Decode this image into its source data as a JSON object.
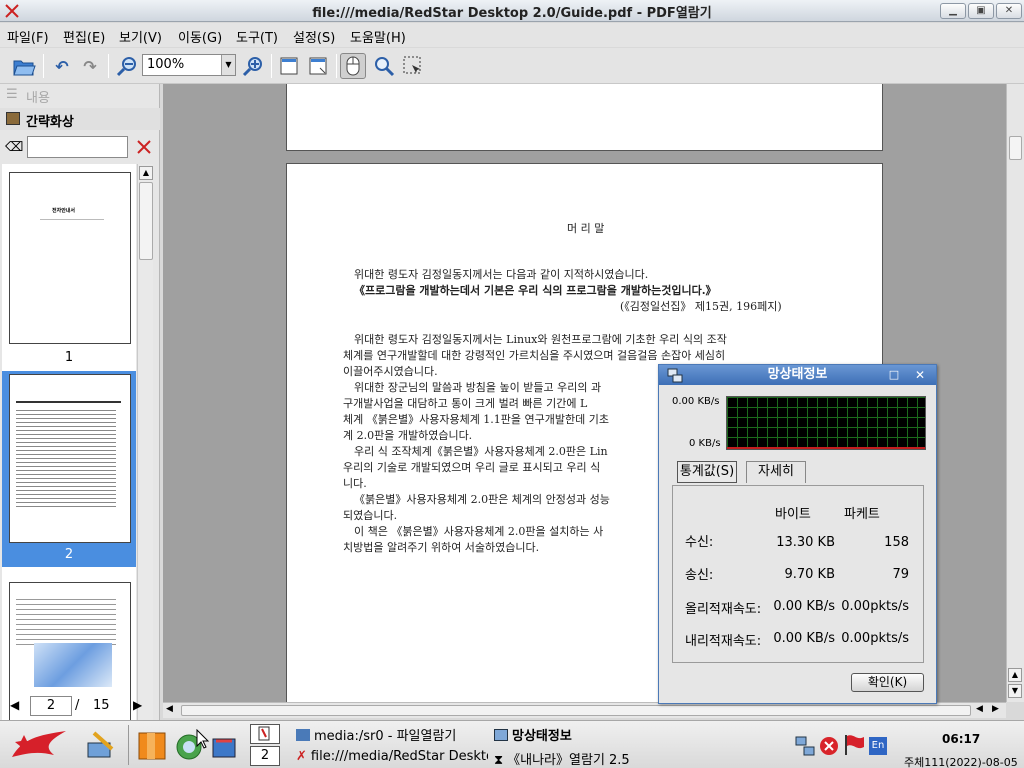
{
  "window": {
    "title": "file:///media/RedStar Desktop 2.0/Guide.pdf - PDF열람기"
  },
  "menu": [
    "파일(F)",
    "편집(E)",
    "보기(V)",
    "이동(G)",
    "도구(T)",
    "설정(S)",
    "도움말(H)"
  ],
  "toolbar": {
    "zoom": "100%"
  },
  "sidebar": {
    "tab_contents": "내용",
    "tab_thumbnails": "간략화상",
    "search_placeholder": "",
    "thumbs": [
      {
        "num": "1"
      },
      {
        "num": "2"
      }
    ],
    "current_page": "2",
    "page_sep": "/",
    "total_pages": "15"
  },
  "thumb1": {
    "title": "전자안내서"
  },
  "document": {
    "heading": "머 리 말",
    "quote_intro": "위대한 령도자 김정일동지께서는 다음과 같이 지적하시였습니다.",
    "quote": "《프로그람을 개발하는데서 기본은 우리 식의 프로그람을 개발하는것입니다.》",
    "quote_src": "(《김정일선집》 제15권, 196페지)",
    "p1_l1": "위대한 령도자 김정일동지께서는 Linux와 원천프로그람에 기초한 우리 식의 조작",
    "p1_l2": "체계를 연구개발할데 대한 강령적인 가르치심을 주시였으며 걸음걸음 손잡아 세심히",
    "p1_l3": "이끌어주시였습니다.",
    "p2_l1": "위대한 장군님의 말씀과 방침을 높이 받들고 우리의 과",
    "p2_l2": "구개발사업을 대담하고 통이 크게 벌려 빠른 기간에 L",
    "p2_l3": "체계 《붉은별》사용자용체계 1.1판을 연구개발한데 기초",
    "p2_l4": "계 2.0판을 개발하였습니다.",
    "p3_l1": "우리 식 조작체계《붉은별》사용자용체계 2.0판은 Lin",
    "p3_l2": "우리의 기술로 개발되였으며 우리 글로 표시되고 우리 식",
    "p3_l3": "니다.",
    "p4_l1": "《붉은별》사용자용체계 2.0판은 체계의 안정성과 성능",
    "p4_l2": "되였습니다.",
    "p5_l1": "이 책은 《붉은별》사용자용체계 2.0판을 설치하는 사",
    "p5_l2": "치방법을 알려주기 위하여 서술하였습니다."
  },
  "dialog": {
    "title": "망상태정보",
    "graph_top": "0.00 KB/s",
    "graph_bottom": "0 KB/s",
    "tab_stats": "통계값(S)",
    "tab_detail": "자세히",
    "col_bytes": "바이트",
    "col_packets": "파케트",
    "rows": [
      {
        "label": "수신:",
        "bytes": "13.30 KB",
        "packets": "158"
      },
      {
        "label": "송신:",
        "bytes": "9.70 KB",
        "packets": "79"
      },
      {
        "label": "올리적재속도:",
        "bytes": "0.00 KB/s",
        "packets": "0.00pkts/s"
      },
      {
        "label": "내리적재속도:",
        "bytes": "0.00 KB/s",
        "packets": "0.00pkts/s"
      }
    ],
    "ok": "확인(K)"
  },
  "taskbar": {
    "desktop_num": "2",
    "tasks": [
      "media:/sr0 - 파일열람기",
      "망상태정보",
      "file:///media/RedStar Desktop",
      "《내나라》열람기 2.5"
    ],
    "clock": "06:17",
    "date": "주체111(2022)-08-05",
    "lang": "En"
  }
}
